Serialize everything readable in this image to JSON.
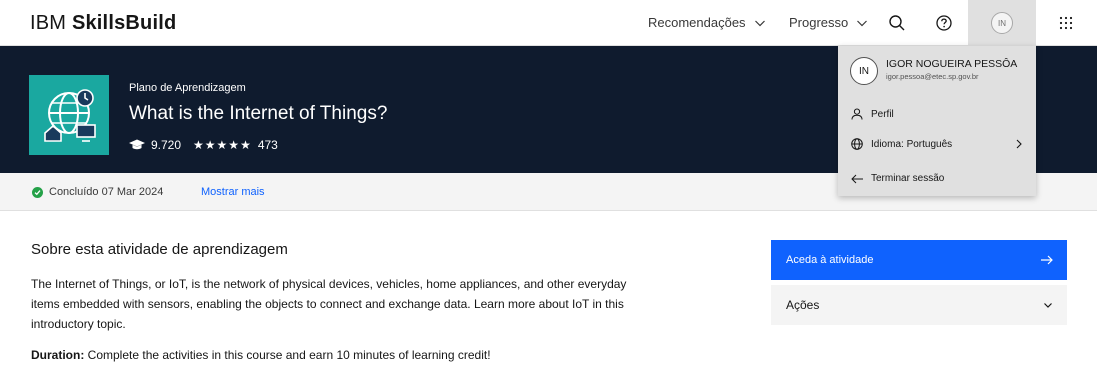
{
  "header": {
    "brand_light": "IBM",
    "brand_bold": "SkillsBuild",
    "nav": [
      {
        "label": "Recomendações"
      },
      {
        "label": "Progresso"
      }
    ],
    "user_initials": "IN"
  },
  "hero": {
    "kicker": "Plano de Aprendizagem",
    "title": "What is the Internet of Things?",
    "learners": "9.720",
    "rating_count": "473",
    "stars": "★★★★★"
  },
  "status": {
    "completed": "Concluído 07 Mar 2024",
    "show_more": "Mostrar mais"
  },
  "main": {
    "about_title": "Sobre esta atividade de aprendizagem",
    "about_text": "The Internet of Things, or IoT, is the network of physical devices, vehicles, home appliances, and other everyday items embedded with sensors, enabling the objects to connect and exchange data. Learn more about IoT in this introductory topic.",
    "duration_label": "Duration:",
    "duration_text": " Complete the activities in this course and earn 10 minutes of learning credit!",
    "primary_button": "Aceda à atividade",
    "actions_button": "Ações"
  },
  "user_menu": {
    "initials": "IN",
    "name": "IGOR NOGUEIRA PESSÔA",
    "email": "igor.pessoa@etec.sp.gov.br",
    "profile": "Perfil",
    "language": "Idioma: Português",
    "logout": "Terminar sessão"
  },
  "colors": {
    "hero_bg": "#0f1b2e",
    "accent": "#0f62fe",
    "success": "#24a148",
    "thumb": "#1aa8a0"
  }
}
